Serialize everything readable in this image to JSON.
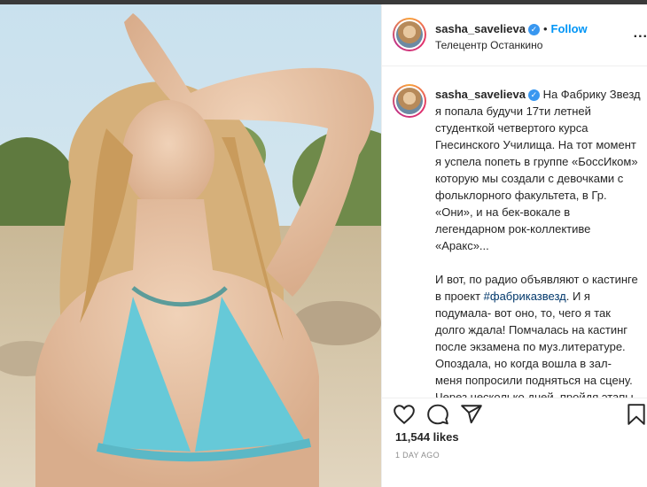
{
  "post": {
    "username": "sasha_savelieva",
    "verified_icon": "verified-badge-icon",
    "separator": "•",
    "follow_label": "Follow",
    "location": "Телецентр Останкино",
    "more_label": "...",
    "caption_part1": "На Фабрику Звезд я попала будучи 17ти летней студенткой четвертого курса Гнесинского Училища. На тот момент я успела попеть в группе «БоссИком» которую мы создали с девочками с фольклорного факультета, в Гр. «Они», и на бек-вокале в легендарном рок-коллективе «Аракс»...\n\nИ вот, по радио объявляют о кастинге в проект ",
    "caption_hashtag": "#фабриказвезд",
    "caption_part2": ". И я подумала- вот оно, то, чего я так долго ждала! Помчалась на кастинг после экзамена по муз.литературе. Опоздала, но когда вошла в зал- меня попросили подняться на сцену. Через несколько дней, пройдя этапы конкурсного отбора( на студии, с",
    "likes": "11,544 likes",
    "time_ago": "1 DAY AGO"
  },
  "actions": {
    "like_icon": "heart-icon",
    "comment_icon": "comment-icon",
    "share_icon": "share-icon",
    "save_icon": "bookmark-icon"
  },
  "colors": {
    "accent": "#0095f6",
    "verified": "#3897f0",
    "hashtag": "#00376b",
    "muted": "#8e8e8e"
  }
}
